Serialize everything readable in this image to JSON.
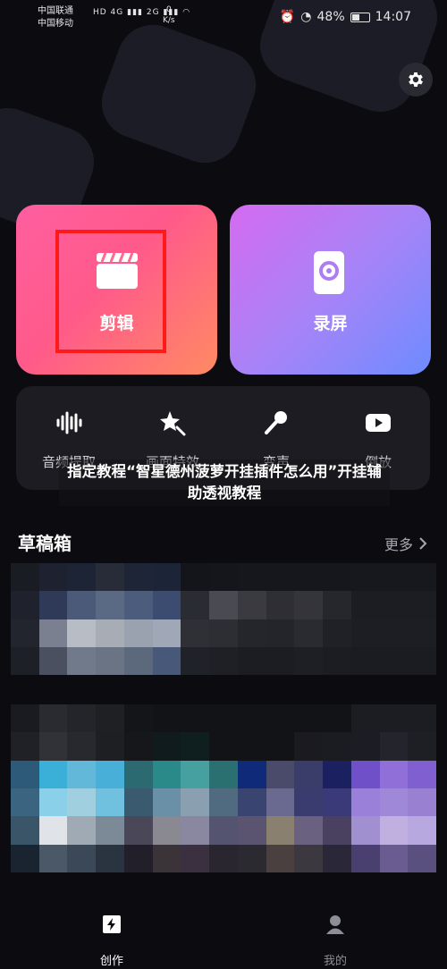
{
  "status_bar": {
    "carrier1": "中国联通",
    "carrier2": "中国移动",
    "network1": "HD 4G",
    "network2": "2G",
    "speed_value": "0",
    "speed_unit": "K/s",
    "battery": "48%",
    "time": "14:07"
  },
  "cards": {
    "edit_label": "剪辑",
    "record_label": "录屏"
  },
  "tools": [
    {
      "label": "音频提取",
      "icon": "audio-wave-icon"
    },
    {
      "label": "画面特效",
      "icon": "magic-star-icon"
    },
    {
      "label": "变声",
      "icon": "microphone-icon"
    },
    {
      "label": "倒放",
      "icon": "play-icon"
    }
  ],
  "overlay": {
    "title": "指定教程“智星德州菠萝开挂插件怎么用”开挂辅助透视教程"
  },
  "drafts": {
    "title": "草稿箱",
    "more_label": "更多"
  },
  "bottom_nav": {
    "create_label": "创作",
    "mine_label": "我的"
  },
  "colors": {
    "edit_card": "#ff5f9a",
    "record_card": "#a883f7",
    "highlight_box": "#ff1a1a",
    "background": "#0b0b10"
  }
}
